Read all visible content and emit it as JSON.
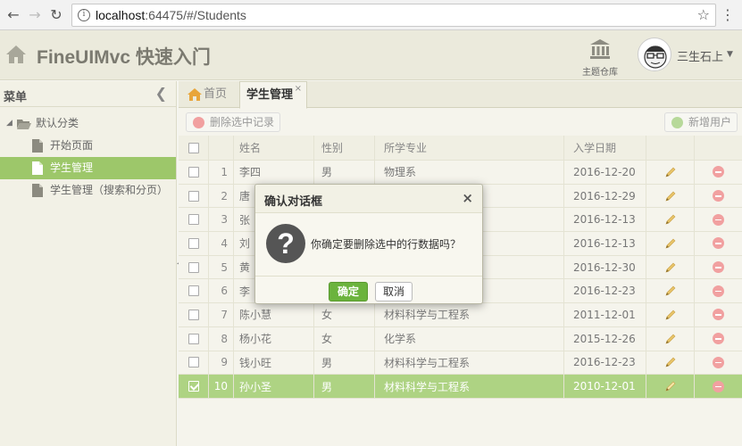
{
  "browser": {
    "url_host": "localhost",
    "url_rest": ":64475/#/Students",
    "back_glyph": "←",
    "forward_glyph": "→",
    "reload_glyph": "↻",
    "info_glyph": "i",
    "star_glyph": "☆",
    "menu_glyph": "⋮"
  },
  "header": {
    "title": "FineUIMvc 快速入门",
    "theme_label": "主题仓库",
    "user_name": "三生石上",
    "user_caret": "▼"
  },
  "sidebar": {
    "title": "菜单",
    "collapse_glyph": "❮",
    "root": {
      "label": "默认分类",
      "arrow": "◢"
    },
    "items": [
      {
        "label": "开始页面",
        "selected": false
      },
      {
        "label": "学生管理",
        "selected": true
      },
      {
        "label": "学生管理（搜索和分页）",
        "selected": false
      }
    ]
  },
  "tabs": {
    "home": "首页",
    "active": "学生管理",
    "close_glyph": "×"
  },
  "toolbar": {
    "delete_label": "删除选中记录",
    "add_label": "新增用户"
  },
  "grid": {
    "columns": [
      "姓名",
      "性别",
      "所学专业",
      "入学日期"
    ],
    "rows": [
      {
        "num": "1",
        "name": "李四",
        "gender": "男",
        "major": "物理系",
        "date": "2016-12-20",
        "selected": false
      },
      {
        "num": "2",
        "name": "唐",
        "gender": "",
        "major": "",
        "date": "2016-12-29",
        "selected": false
      },
      {
        "num": "3",
        "name": "张",
        "gender": "",
        "major": "",
        "date": "2016-12-13",
        "selected": false
      },
      {
        "num": "4",
        "name": "刘",
        "gender": "",
        "major": "",
        "date": "2016-12-13",
        "selected": false
      },
      {
        "num": "5",
        "name": "黄",
        "gender": "",
        "major": "",
        "date": "2016-12-30",
        "selected": false
      },
      {
        "num": "6",
        "name": "李",
        "gender": "",
        "major": "",
        "date": "2016-12-23",
        "selected": false
      },
      {
        "num": "7",
        "name": "陈小慧",
        "gender": "女",
        "major": "材料科学与工程系",
        "date": "2011-12-01",
        "selected": false
      },
      {
        "num": "8",
        "name": "杨小花",
        "gender": "女",
        "major": "化学系",
        "date": "2015-12-26",
        "selected": false
      },
      {
        "num": "9",
        "name": "钱小旺",
        "gender": "男",
        "major": "材料科学与工程系",
        "date": "2016-12-23",
        "selected": false
      },
      {
        "num": "10",
        "name": "孙小圣",
        "gender": "男",
        "major": "材料科学与工程系",
        "date": "2010-12-01",
        "selected": true
      }
    ]
  },
  "dialog": {
    "title": "确认对话框",
    "close_glyph": "×",
    "icon_glyph": "?",
    "message": "你确定要删除选中的行数据吗？",
    "ok_label": "确定",
    "cancel_label": "取消"
  },
  "colors": {
    "accent_green": "#9dc76a",
    "selected_row": "#aed383",
    "ok_button": "#6bb33d",
    "delete_icon": "#f1a0a0"
  }
}
